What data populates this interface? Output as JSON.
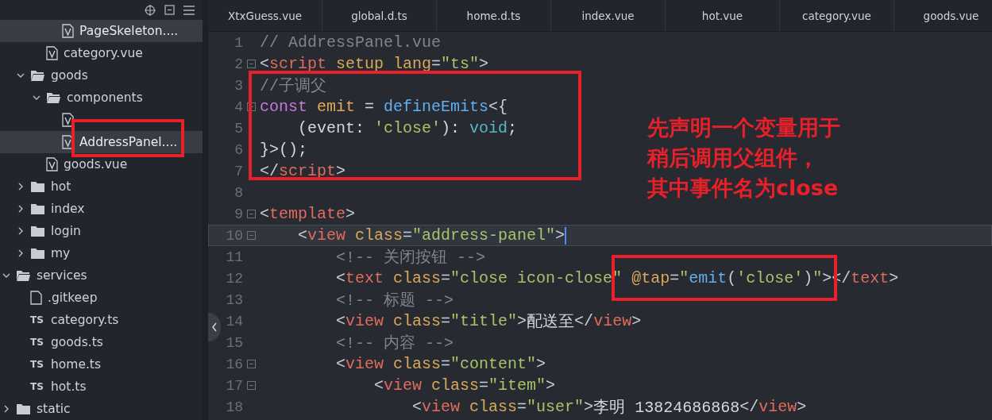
{
  "sidebar": {
    "tree": [
      {
        "children": [
          {
            "children": [
              {
                "children": [
                  {
                    "label": "PageSkeleton....",
                    "kind": "vue",
                    "selected": true
                  }
                ]
              },
              {
                "label": "category.vue",
                "kind": "vue",
                "selected": false
              }
            ]
          },
          {
            "label": "goods",
            "kind": "folder",
            "expanded": true,
            "selected": false,
            "children": [
              {
                "label": "components",
                "kind": "folder",
                "expanded": true,
                "selected": false,
                "children": [
                  {
                    "kind": "vue",
                    "selected": false
                  },
                  {
                    "label": "AddressPanel....",
                    "kind": "vue",
                    "selected": true
                  }
                ]
              },
              {
                "label": "goods.vue",
                "kind": "vue",
                "selected": false
              }
            ]
          },
          {
            "label": "hot",
            "kind": "folder",
            "expanded": false,
            "selected": false
          },
          {
            "label": "index",
            "kind": "folder",
            "expanded": false,
            "selected": false
          },
          {
            "label": "login",
            "kind": "folder",
            "expanded": false,
            "selected": false
          },
          {
            "label": "my",
            "kind": "folder",
            "expanded": false,
            "selected": false
          }
        ]
      },
      {
        "label": "services",
        "kind": "folder",
        "expanded": true,
        "selected": false,
        "children": [
          {
            "label": ".gitkeep",
            "kind": "file",
            "selected": false
          },
          {
            "label": "category.ts",
            "kind": "ts",
            "badge": "TS",
            "selected": false
          },
          {
            "label": "goods.ts",
            "kind": "ts",
            "badge": "TS",
            "selected": false
          },
          {
            "label": "home.ts",
            "kind": "ts",
            "badge": "TS",
            "selected": false
          },
          {
            "label": "hot.ts",
            "kind": "ts",
            "badge": "TS",
            "selected": false
          }
        ]
      },
      {
        "label": "static",
        "kind": "folder",
        "expanded": false,
        "selected": false
      }
    ]
  },
  "tabs": [
    {
      "label": "XtxGuess.vue",
      "selected": false
    },
    {
      "label": "global.d.ts",
      "selected": false
    },
    {
      "label": "home.d.ts",
      "selected": false
    },
    {
      "label": "index.vue",
      "selected": false
    },
    {
      "label": "hot.vue",
      "selected": false
    },
    {
      "label": "category.vue",
      "selected": false
    },
    {
      "label": "goods.vue",
      "selected": false
    }
  ],
  "editor": {
    "lines": [
      {
        "number": "1",
        "fold": false,
        "current": false,
        "tokens": [
          {
            "kind": "comment",
            "text": "// AddressPanel.vue"
          }
        ]
      },
      {
        "number": "2",
        "fold": true,
        "current": false,
        "tokens": [
          {
            "kind": "punct",
            "text": "<"
          },
          {
            "kind": "tag",
            "text": "script"
          },
          {
            "kind": "attr",
            "text": " setup"
          },
          {
            "kind": "attr",
            "text": " lang"
          },
          {
            "kind": "punct",
            "text": "="
          },
          {
            "kind": "string",
            "text": "\"ts\""
          },
          {
            "kind": "punct",
            "text": ">"
          }
        ]
      },
      {
        "number": "3",
        "fold": false,
        "current": false,
        "tokens": [
          {
            "kind": "comment",
            "text": "//子调父"
          }
        ]
      },
      {
        "number": "4",
        "fold": true,
        "current": false,
        "tokens": [
          {
            "kind": "keyword",
            "text": "const"
          },
          {
            "kind": "variable",
            "text": " emit"
          },
          {
            "kind": "plain",
            "text": " = "
          },
          {
            "kind": "func",
            "text": "defineEmits"
          },
          {
            "kind": "punct",
            "text": "<{"
          }
        ]
      },
      {
        "number": "5",
        "fold": false,
        "current": false,
        "tokens": [
          {
            "kind": "plain",
            "text": "    (event: "
          },
          {
            "kind": "string",
            "text": "'close'"
          },
          {
            "kind": "plain",
            "text": "): "
          },
          {
            "kind": "type",
            "text": "void"
          },
          {
            "kind": "plain",
            "text": ";"
          }
        ]
      },
      {
        "number": "6",
        "fold": false,
        "current": false,
        "tokens": [
          {
            "kind": "plain",
            "text": "}>();"
          }
        ]
      },
      {
        "number": "7",
        "fold": false,
        "current": false,
        "tokens": [
          {
            "kind": "punct",
            "text": "</"
          },
          {
            "kind": "tag",
            "text": "script"
          },
          {
            "kind": "punct",
            "text": ">"
          }
        ]
      },
      {
        "number": "8",
        "fold": false,
        "current": false
      },
      {
        "number": "9",
        "fold": true,
        "current": false,
        "tokens": [
          {
            "kind": "punct",
            "text": "<"
          },
          {
            "kind": "tag",
            "text": "template"
          },
          {
            "kind": "punct",
            "text": ">"
          }
        ]
      },
      {
        "number": "10",
        "fold": true,
        "current": true,
        "tokens": [
          {
            "kind": "punct",
            "text": "    <"
          },
          {
            "kind": "tag",
            "text": "view"
          },
          {
            "kind": "attr",
            "text": " class"
          },
          {
            "kind": "punct",
            "text": "="
          },
          {
            "kind": "string",
            "text": "\"address-panel\""
          },
          {
            "kind": "punct",
            "text": ">"
          }
        ]
      },
      {
        "number": "11",
        "fold": false,
        "current": false,
        "tokens": [
          {
            "kind": "comment",
            "text": "        <!-- 关闭按钮 -->"
          }
        ]
      },
      {
        "number": "12",
        "fold": false,
        "current": false,
        "tokens": [
          {
            "kind": "punct",
            "text": "        <"
          },
          {
            "kind": "tag",
            "text": "text"
          },
          {
            "kind": "attr",
            "text": " class"
          },
          {
            "kind": "punct",
            "text": "="
          },
          {
            "kind": "string",
            "text": "\"close icon-close\""
          },
          {
            "kind": "attr",
            "text": " @tap"
          },
          {
            "kind": "punct",
            "text": "="
          },
          {
            "kind": "string",
            "text": "\""
          },
          {
            "kind": "func",
            "text": "emit"
          },
          {
            "kind": "punct",
            "text": "("
          },
          {
            "kind": "string",
            "text": "'close'"
          },
          {
            "kind": "punct",
            "text": ")"
          },
          {
            "kind": "string",
            "text": "\""
          },
          {
            "kind": "punct",
            "text": "></"
          },
          {
            "kind": "tag",
            "text": "text"
          },
          {
            "kind": "punct",
            "text": ">"
          }
        ]
      },
      {
        "number": "13",
        "fold": false,
        "current": false,
        "tokens": [
          {
            "kind": "comment",
            "text": "        <!-- 标题 -->"
          }
        ]
      },
      {
        "number": "14",
        "fold": false,
        "current": false,
        "tokens": [
          {
            "kind": "punct",
            "text": "        <"
          },
          {
            "kind": "tag",
            "text": "view"
          },
          {
            "kind": "attr",
            "text": " class"
          },
          {
            "kind": "punct",
            "text": "="
          },
          {
            "kind": "string",
            "text": "\"title\""
          },
          {
            "kind": "punct",
            "text": ">"
          },
          {
            "kind": "plain",
            "text": "配送至"
          },
          {
            "kind": "punct",
            "text": "</"
          },
          {
            "kind": "tag",
            "text": "view"
          },
          {
            "kind": "punct",
            "text": ">"
          }
        ]
      },
      {
        "number": "15",
        "fold": false,
        "current": false,
        "tokens": [
          {
            "kind": "comment",
            "text": "        <!-- 内容 -->"
          }
        ]
      },
      {
        "number": "16",
        "fold": true,
        "current": false,
        "tokens": [
          {
            "kind": "punct",
            "text": "        <"
          },
          {
            "kind": "tag",
            "text": "view"
          },
          {
            "kind": "attr",
            "text": " class"
          },
          {
            "kind": "punct",
            "text": "="
          },
          {
            "kind": "string",
            "text": "\"content\""
          },
          {
            "kind": "punct",
            "text": ">"
          }
        ]
      },
      {
        "number": "17",
        "fold": true,
        "current": false,
        "tokens": [
          {
            "kind": "punct",
            "text": "            <"
          },
          {
            "kind": "tag",
            "text": "view"
          },
          {
            "kind": "attr",
            "text": " class"
          },
          {
            "kind": "punct",
            "text": "="
          },
          {
            "kind": "string",
            "text": "\"item\""
          },
          {
            "kind": "punct",
            "text": ">"
          }
        ]
      },
      {
        "number": "18",
        "fold": false,
        "current": false,
        "tokens": [
          {
            "kind": "punct",
            "text": "                <"
          },
          {
            "kind": "tag",
            "text": "view"
          },
          {
            "kind": "attr",
            "text": " class"
          },
          {
            "kind": "punct",
            "text": "="
          },
          {
            "kind": "string",
            "text": "\"user\""
          },
          {
            "kind": "punct",
            "text": ">"
          },
          {
            "kind": "plain",
            "text": "李明 13824686868"
          },
          {
            "kind": "punct",
            "text": "</"
          },
          {
            "kind": "tag",
            "text": "view"
          },
          {
            "kind": "punct",
            "text": ">"
          }
        ]
      }
    ]
  },
  "annotation": {
    "note_lines": [
      "先声明一个变量用于",
      "稍后调用父组件，",
      "其中事件名为close"
    ]
  }
}
